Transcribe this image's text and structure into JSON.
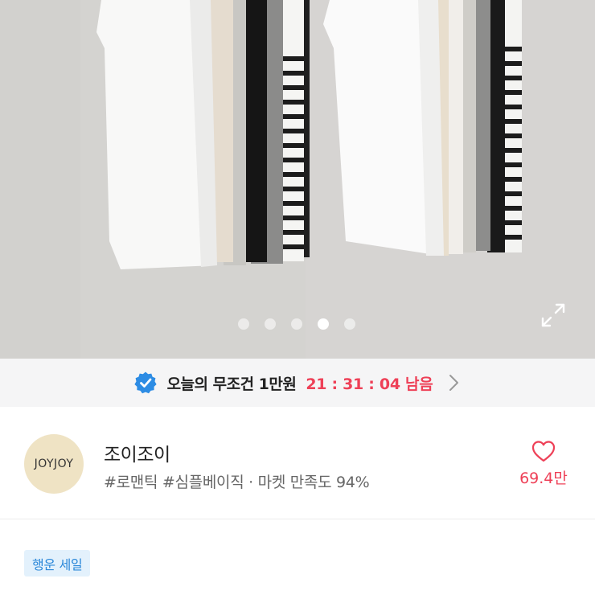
{
  "gallery": {
    "slide_count": 5,
    "active_index": 3,
    "expand_icon": "expand-icon"
  },
  "promo": {
    "badge_icon": "verified-check-icon",
    "text": "오늘의 무조건 1만원",
    "timer": "21 : 31 : 04 남음",
    "timer_color": "#ee4057"
  },
  "shop": {
    "logo_text": "JOYJOY",
    "name": "조이조이",
    "tags": "#로맨틱 #심플베이직 · 마켓 만족도 94%",
    "like_icon": "heart-icon",
    "like_count": "69.4만"
  },
  "sale": {
    "label": "행운 세일"
  }
}
